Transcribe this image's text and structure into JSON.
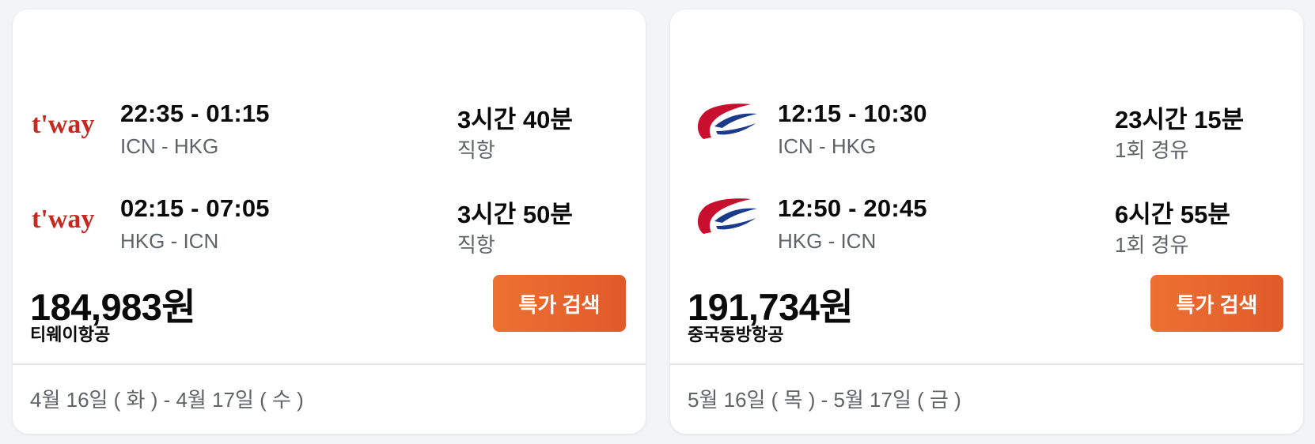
{
  "cards": [
    {
      "legs": [
        {
          "logo": "tway-logo",
          "times": "22:35 - 01:15",
          "route": "ICN - HKG",
          "duration": "3시간 40분",
          "stops": "직항"
        },
        {
          "logo": "tway-logo",
          "times": "02:15 - 07:05",
          "route": "HKG - ICN",
          "duration": "3시간 50분",
          "stops": "직항"
        }
      ],
      "price": "184,983원",
      "airline": "티웨이항공",
      "button_label": "특가 검색",
      "dates": "4월 16일 ( 화 )  - 4월 17일 ( 수 )",
      "logo_text": "t'way",
      "logo_color": "#c8281e",
      "logo_accent": "#5a8a2a"
    },
    {
      "legs": [
        {
          "logo": "china-eastern-logo",
          "times": "12:15 - 10:30",
          "route": "ICN - HKG",
          "duration": "23시간 15분",
          "stops": "1회 경유"
        },
        {
          "logo": "china-eastern-logo",
          "times": "12:50 - 20:45",
          "route": "HKG - ICN",
          "duration": "6시간 55분",
          "stops": "1회 경유"
        }
      ],
      "price": "191,734원",
      "airline": "중국동방항공",
      "button_label": "특가 검색",
      "dates": "5월 16일 ( 목 )  - 5월 17일 ( 금 )",
      "logo_red": "#c8102e",
      "logo_blue": "#1a3a8c"
    }
  ],
  "colors": {
    "button": "#e8632d",
    "muted_text": "#5f6368",
    "card_bg": "#ffffff",
    "page_bg": "#f3f4f6"
  }
}
